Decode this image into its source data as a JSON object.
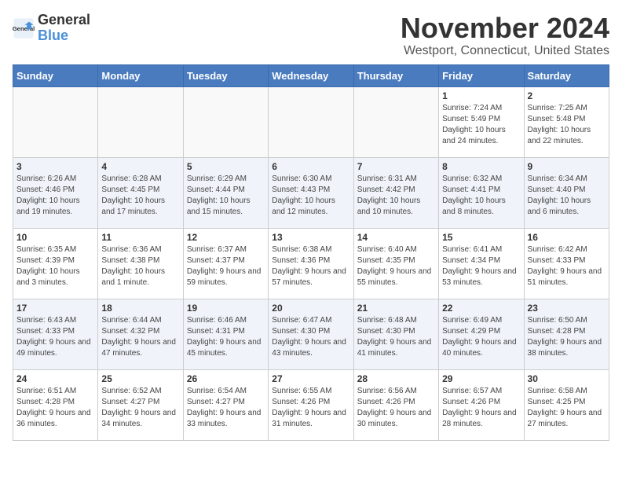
{
  "logo": {
    "line1": "General",
    "line2": "Blue"
  },
  "title": "November 2024",
  "location": "Westport, Connecticut, United States",
  "weekdays": [
    "Sunday",
    "Monday",
    "Tuesday",
    "Wednesday",
    "Thursday",
    "Friday",
    "Saturday"
  ],
  "weeks": [
    [
      {
        "day": "",
        "info": ""
      },
      {
        "day": "",
        "info": ""
      },
      {
        "day": "",
        "info": ""
      },
      {
        "day": "",
        "info": ""
      },
      {
        "day": "",
        "info": ""
      },
      {
        "day": "1",
        "info": "Sunrise: 7:24 AM\nSunset: 5:49 PM\nDaylight: 10 hours and 24 minutes."
      },
      {
        "day": "2",
        "info": "Sunrise: 7:25 AM\nSunset: 5:48 PM\nDaylight: 10 hours and 22 minutes."
      }
    ],
    [
      {
        "day": "3",
        "info": "Sunrise: 6:26 AM\nSunset: 4:46 PM\nDaylight: 10 hours and 19 minutes."
      },
      {
        "day": "4",
        "info": "Sunrise: 6:28 AM\nSunset: 4:45 PM\nDaylight: 10 hours and 17 minutes."
      },
      {
        "day": "5",
        "info": "Sunrise: 6:29 AM\nSunset: 4:44 PM\nDaylight: 10 hours and 15 minutes."
      },
      {
        "day": "6",
        "info": "Sunrise: 6:30 AM\nSunset: 4:43 PM\nDaylight: 10 hours and 12 minutes."
      },
      {
        "day": "7",
        "info": "Sunrise: 6:31 AM\nSunset: 4:42 PM\nDaylight: 10 hours and 10 minutes."
      },
      {
        "day": "8",
        "info": "Sunrise: 6:32 AM\nSunset: 4:41 PM\nDaylight: 10 hours and 8 minutes."
      },
      {
        "day": "9",
        "info": "Sunrise: 6:34 AM\nSunset: 4:40 PM\nDaylight: 10 hours and 6 minutes."
      }
    ],
    [
      {
        "day": "10",
        "info": "Sunrise: 6:35 AM\nSunset: 4:39 PM\nDaylight: 10 hours and 3 minutes."
      },
      {
        "day": "11",
        "info": "Sunrise: 6:36 AM\nSunset: 4:38 PM\nDaylight: 10 hours and 1 minute."
      },
      {
        "day": "12",
        "info": "Sunrise: 6:37 AM\nSunset: 4:37 PM\nDaylight: 9 hours and 59 minutes."
      },
      {
        "day": "13",
        "info": "Sunrise: 6:38 AM\nSunset: 4:36 PM\nDaylight: 9 hours and 57 minutes."
      },
      {
        "day": "14",
        "info": "Sunrise: 6:40 AM\nSunset: 4:35 PM\nDaylight: 9 hours and 55 minutes."
      },
      {
        "day": "15",
        "info": "Sunrise: 6:41 AM\nSunset: 4:34 PM\nDaylight: 9 hours and 53 minutes."
      },
      {
        "day": "16",
        "info": "Sunrise: 6:42 AM\nSunset: 4:33 PM\nDaylight: 9 hours and 51 minutes."
      }
    ],
    [
      {
        "day": "17",
        "info": "Sunrise: 6:43 AM\nSunset: 4:33 PM\nDaylight: 9 hours and 49 minutes."
      },
      {
        "day": "18",
        "info": "Sunrise: 6:44 AM\nSunset: 4:32 PM\nDaylight: 9 hours and 47 minutes."
      },
      {
        "day": "19",
        "info": "Sunrise: 6:46 AM\nSunset: 4:31 PM\nDaylight: 9 hours and 45 minutes."
      },
      {
        "day": "20",
        "info": "Sunrise: 6:47 AM\nSunset: 4:30 PM\nDaylight: 9 hours and 43 minutes."
      },
      {
        "day": "21",
        "info": "Sunrise: 6:48 AM\nSunset: 4:30 PM\nDaylight: 9 hours and 41 minutes."
      },
      {
        "day": "22",
        "info": "Sunrise: 6:49 AM\nSunset: 4:29 PM\nDaylight: 9 hours and 40 minutes."
      },
      {
        "day": "23",
        "info": "Sunrise: 6:50 AM\nSunset: 4:28 PM\nDaylight: 9 hours and 38 minutes."
      }
    ],
    [
      {
        "day": "24",
        "info": "Sunrise: 6:51 AM\nSunset: 4:28 PM\nDaylight: 9 hours and 36 minutes."
      },
      {
        "day": "25",
        "info": "Sunrise: 6:52 AM\nSunset: 4:27 PM\nDaylight: 9 hours and 34 minutes."
      },
      {
        "day": "26",
        "info": "Sunrise: 6:54 AM\nSunset: 4:27 PM\nDaylight: 9 hours and 33 minutes."
      },
      {
        "day": "27",
        "info": "Sunrise: 6:55 AM\nSunset: 4:26 PM\nDaylight: 9 hours and 31 minutes."
      },
      {
        "day": "28",
        "info": "Sunrise: 6:56 AM\nSunset: 4:26 PM\nDaylight: 9 hours and 30 minutes."
      },
      {
        "day": "29",
        "info": "Sunrise: 6:57 AM\nSunset: 4:26 PM\nDaylight: 9 hours and 28 minutes."
      },
      {
        "day": "30",
        "info": "Sunrise: 6:58 AM\nSunset: 4:25 PM\nDaylight: 9 hours and 27 minutes."
      }
    ]
  ]
}
